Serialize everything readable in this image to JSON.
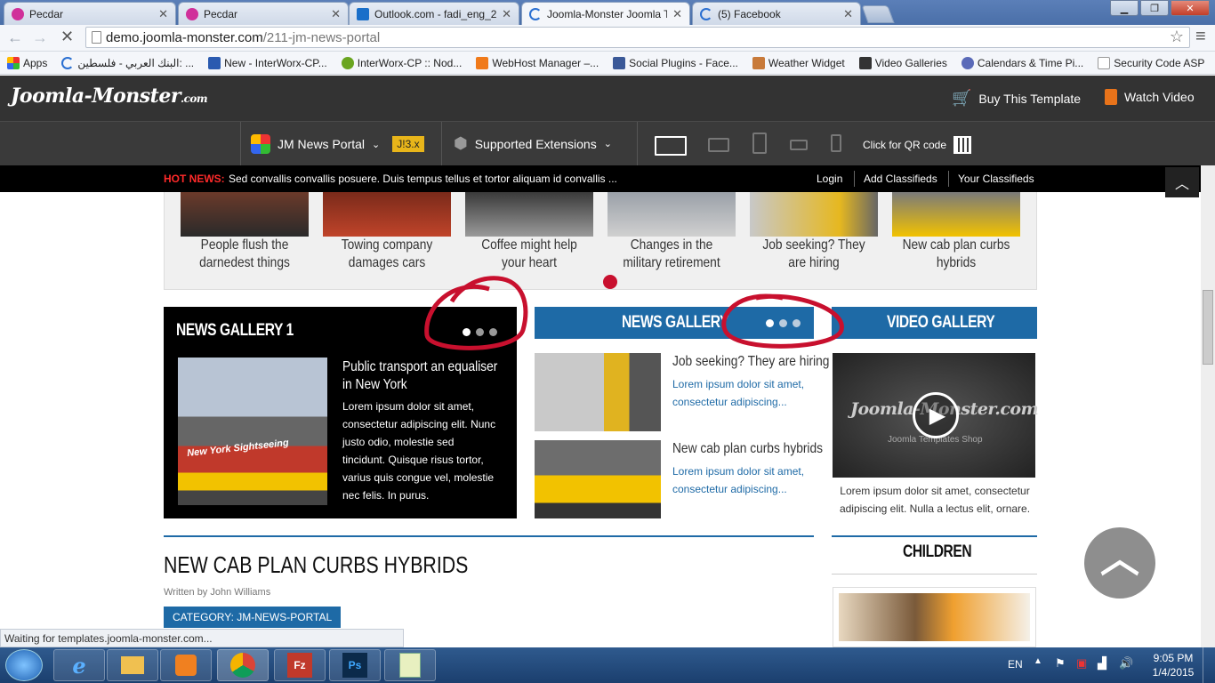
{
  "browser": {
    "tabs": [
      {
        "title": "Pecdar",
        "icon": "joomla-icon"
      },
      {
        "title": "Pecdar",
        "icon": "joomla-icon"
      },
      {
        "title": "Outlook.com - fadi_eng_2",
        "icon": "outlook-icon"
      },
      {
        "title": "Joomla-Monster Joomla T",
        "icon": "loading-icon"
      },
      {
        "title": "(5) Facebook",
        "icon": "loading-icon"
      }
    ],
    "url_host": "demo.joomla-monster.com",
    "url_path": "/211-jm-news-portal",
    "bookmarks": [
      {
        "label": "Apps",
        "icon": "apps-grid-icon"
      },
      {
        "label": "البنك العربي - فلسطين: ...",
        "icon": "loading-icon"
      },
      {
        "label": "New - InterWorx-CP...",
        "icon": "interworx-icon"
      },
      {
        "label": "InterWorx-CP :: Nod...",
        "icon": "interworx-icon"
      },
      {
        "label": "WebHost Manager –...",
        "icon": "cpanel-icon"
      },
      {
        "label": "Social Plugins - Face...",
        "icon": "facebook-icon"
      },
      {
        "label": "Weather Widget",
        "icon": "weather-icon"
      },
      {
        "label": "Video Galleries",
        "icon": "s-icon"
      },
      {
        "label": "Calendars & Time Pi...",
        "icon": "calendar-icon"
      },
      {
        "label": "Security Code ASP",
        "icon": "page-icon"
      }
    ],
    "status": "Waiting for templates.joomla-monster.com..."
  },
  "site": {
    "logo_main": "Joomla-Monster",
    "logo_suffix": ".com",
    "buy": "Buy This Template",
    "watch": "Watch Video",
    "nav_template": "JM News Portal",
    "nav_badge": "J!3.x",
    "nav_ext": "Supported Extensions",
    "qr": "Click for QR code",
    "hot_label": "HOT NEWS:",
    "hot_text": "Sed convallis convallis posuere. Duis tempus tellus et tortor aliquam id convallis ...",
    "login": "Login",
    "add_classifieds": "Add Classifieds",
    "your_classifieds": "Your Classifieds"
  },
  "strip": [
    "People flush the darnedest things",
    "Towing company damages cars",
    "Coffee might help your heart",
    "Changes in the military retirement",
    "Job seeking? They are hiring",
    "New cab plan curbs hybrids"
  ],
  "gallery1": {
    "title": "NEWS GALLERY 1",
    "article_title": "Public transport an equaliser in New York",
    "article_text": "Lorem ipsum dolor sit amet, consectetur adipiscing elit. Nunc justo odio, molestie sed tincidunt. Quisque risus tortor, varius quis congue vel, molestie nec felis. In purus.",
    "image_text": "New York Sightseeing"
  },
  "gallery2": {
    "title": "NEWS GALLERY",
    "items": [
      {
        "title": "Job seeking? They are hiring",
        "text": "Lorem ipsum dolor sit amet, consectetur adipiscing..."
      },
      {
        "title": "New cab plan curbs hybrids",
        "text": "Lorem ipsum dolor sit amet, consectetur adipiscing..."
      }
    ]
  },
  "video": {
    "title": "VIDEO GALLERY",
    "logo": "Joomla-Monster.com",
    "logo_sub": "Joomla Templates Shop",
    "text": "Lorem ipsum dolor sit amet, consectetur adipiscing elit. Nulla a lectus elit, ornare."
  },
  "article": {
    "title": "NEW CAB PLAN CURBS HYBRIDS",
    "byline": "Written by John Williams",
    "category": "CATEGORY: JM-NEWS-PORTAL"
  },
  "children": {
    "title": "CHILDREN"
  },
  "taskbar": {
    "lang": "EN",
    "time": "9:05 PM",
    "date": "1/4/2015"
  },
  "colors": {
    "accent_blue": "#1e6aa6",
    "annotation_red": "#c8102e",
    "hot_red": "#ff2a2a",
    "badge_yellow": "#e8b51a"
  }
}
